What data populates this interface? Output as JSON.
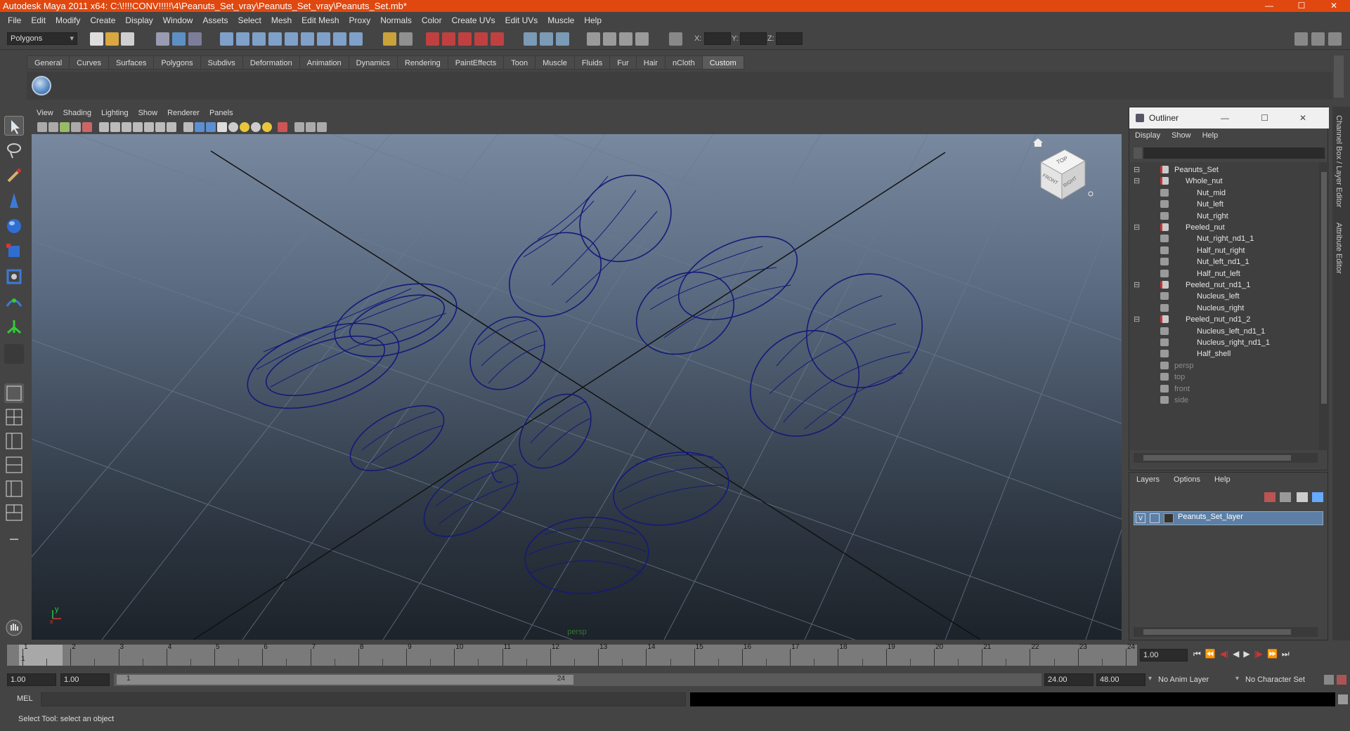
{
  "window": {
    "title": "Autodesk Maya 2011 x64: C:\\!!!!CONV!!!!!\\4\\Peanuts_Set_vray\\Peanuts_Set_vray\\Peanuts_Set.mb*",
    "controls": [
      "—",
      "☐",
      "✕"
    ]
  },
  "menubar": [
    "File",
    "Edit",
    "Modify",
    "Create",
    "Display",
    "Window",
    "Assets",
    "Select",
    "Mesh",
    "Edit Mesh",
    "Proxy",
    "Normals",
    "Color",
    "Create UVs",
    "Edit UVs",
    "Muscle",
    "Help"
  ],
  "statusline": {
    "mode": "Polygons",
    "x_label": "X:",
    "y_label": "Y:",
    "z_label": "Z:"
  },
  "shelf_tabs": [
    "General",
    "Curves",
    "Surfaces",
    "Polygons",
    "Subdivs",
    "Deformation",
    "Animation",
    "Dynamics",
    "Rendering",
    "PaintEffects",
    "Toon",
    "Muscle",
    "Fluids",
    "Fur",
    "Hair",
    "nCloth",
    "Custom"
  ],
  "shelf_active": "Custom",
  "viewport": {
    "menu": [
      "View",
      "Shading",
      "Lighting",
      "Show",
      "Renderer",
      "Panels"
    ],
    "camera_label": "persp",
    "viewcube": {
      "top": "TOP",
      "front": "FRONT",
      "right": "RIGHT"
    },
    "axis": {
      "y": "y",
      "x": "x"
    }
  },
  "outliner": {
    "title": "Outliner",
    "menu": [
      "Display",
      "Show",
      "Help"
    ],
    "items": [
      {
        "label": "Peanuts_Set",
        "indent": 0,
        "expander": true
      },
      {
        "label": "Whole_nut",
        "indent": 1,
        "expander": true
      },
      {
        "label": "Nut_mid",
        "indent": 2
      },
      {
        "label": "Nut_left",
        "indent": 2
      },
      {
        "label": "Nut_right",
        "indent": 2
      },
      {
        "label": "Peeled_nut",
        "indent": 1,
        "expander": true
      },
      {
        "label": "Nut_right_nd1_1",
        "indent": 2
      },
      {
        "label": "Half_nut_right",
        "indent": 2
      },
      {
        "label": "Nut_left_nd1_1",
        "indent": 2
      },
      {
        "label": "Half_nut_left",
        "indent": 2
      },
      {
        "label": "Peeled_nut_nd1_1",
        "indent": 1,
        "expander": true
      },
      {
        "label": "Nucleus_left",
        "indent": 2
      },
      {
        "label": "Nucleus_right",
        "indent": 2
      },
      {
        "label": "Peeled_nut_nd1_2",
        "indent": 1,
        "expander": true
      },
      {
        "label": "Nucleus_left_nd1_1",
        "indent": 2
      },
      {
        "label": "Nucleus_right_nd1_1",
        "indent": 2
      },
      {
        "label": "Half_shell",
        "indent": 2
      },
      {
        "label": "persp",
        "indent": 0,
        "dim": true
      },
      {
        "label": "top",
        "indent": 0,
        "dim": true
      },
      {
        "label": "front",
        "indent": 0,
        "dim": true
      },
      {
        "label": "side",
        "indent": 0,
        "dim": true
      }
    ]
  },
  "layers": {
    "menu": [
      "Layers",
      "Options",
      "Help"
    ],
    "layer_name": "Peanuts_Set_layer",
    "visible_flag": "V"
  },
  "side_tabs": [
    "Channel Box / Layer Editor",
    "Attribute Editor"
  ],
  "timeline": {
    "ticks": [
      "1",
      "2",
      "3",
      "4",
      "5",
      "6",
      "7",
      "8",
      "9",
      "10",
      "11",
      "12",
      "13",
      "14",
      "15",
      "16",
      "17",
      "18",
      "19",
      "20",
      "21",
      "22",
      "23",
      "24"
    ],
    "current_frame": "1",
    "current_time": "1.00"
  },
  "range": {
    "start": "1.00",
    "anim_start": "1.00",
    "range_start_label": "1",
    "range_end_label": "24",
    "end": "24.00",
    "anim_end": "48.00",
    "anim_layer": "No Anim Layer",
    "char_set": "No Character Set"
  },
  "cmdline": {
    "label": "MEL"
  },
  "helpline": {
    "text": "Select Tool: select an object"
  }
}
